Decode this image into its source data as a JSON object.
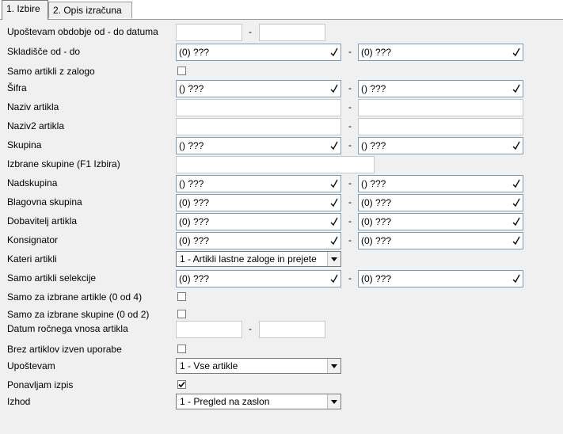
{
  "tabs": [
    {
      "label": "1. Izbire"
    },
    {
      "label": "2. Opis izračuna"
    }
  ],
  "dash": "-",
  "rows": {
    "period": {
      "label": "Upoštevam obdobje od - do datuma",
      "from": "",
      "to": ""
    },
    "warehouse": {
      "label": "Skladišče od - do",
      "from": "(0) ???",
      "to": "(0) ???"
    },
    "stock_only": {
      "label": "Samo artikli z zalogo",
      "checked": false
    },
    "code": {
      "label": "Šifra",
      "from": "() ???",
      "to": "() ???"
    },
    "name": {
      "label": "Naziv artikla",
      "from": "",
      "to": ""
    },
    "name2": {
      "label": "Naziv2 artikla",
      "from": "",
      "to": ""
    },
    "group": {
      "label": "Skupina",
      "from": "() ???",
      "to": "() ???"
    },
    "selected_groups": {
      "label": "Izbrane skupine (F1 Izbira)",
      "value": ""
    },
    "supergroup": {
      "label": "Nadskupina",
      "from": "() ???",
      "to": "() ???"
    },
    "goods_group": {
      "label": "Blagovna skupina",
      "from": "(0) ???",
      "to": "(0) ???"
    },
    "supplier": {
      "label": "Dobavitelj artikla",
      "from": "(0) ???",
      "to": "(0) ???"
    },
    "consignor": {
      "label": "Konsignator",
      "from": "(0) ???",
      "to": "(0) ???"
    },
    "which_articles": {
      "label": "Kateri artikli",
      "value": "1 - Artikli lastne zaloge in prejete"
    },
    "selection_only": {
      "label": "Samo artikli selekcije",
      "from": "(0) ???",
      "to": "(0) ???"
    },
    "selected_articles": {
      "label": "Samo za izbrane artikle (0 od 4)",
      "checked": false
    },
    "selected_groups_only": {
      "label": "Samo za izbrane skupine (0 od 2)",
      "checked": false
    },
    "manual_entry_date": {
      "label": "Datum ročnega vnosa artikla",
      "from": "",
      "to": ""
    },
    "exclude_unused": {
      "label": "Brez artiklov izven uporabe",
      "checked": false
    },
    "consider": {
      "label": "Upoštevam",
      "value": "1 - Vse artikle"
    },
    "repeat_print": {
      "label": "Ponavljam izpis",
      "checked": true
    },
    "output": {
      "label": "Izhod",
      "value": "1 - Pregled na zaslon"
    }
  }
}
